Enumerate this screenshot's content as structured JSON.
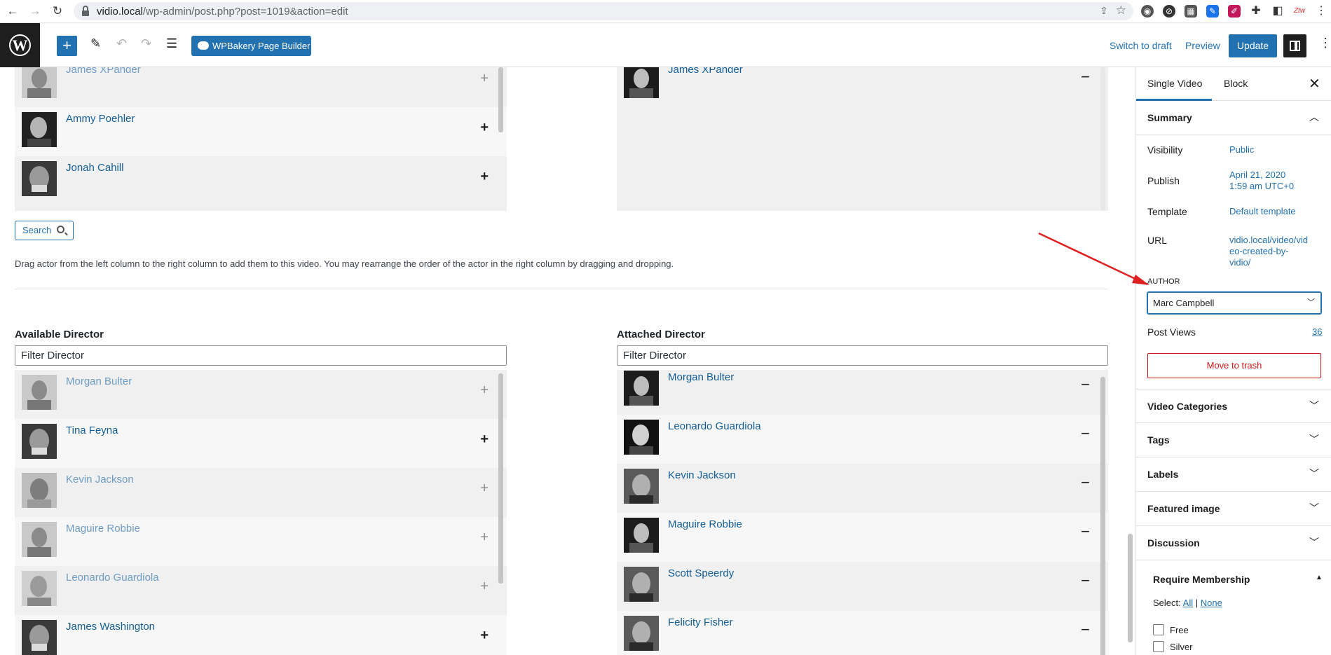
{
  "browser": {
    "url_host": "vidio.local",
    "url_path": "/wp-admin/post.php?post=1019&action=edit"
  },
  "header": {
    "wpbakery_label": "WPBakery Page Builder",
    "switch_to_draft": "Switch to draft",
    "preview": "Preview",
    "update": "Update"
  },
  "actors": {
    "available": [
      {
        "name": "James XPander",
        "faded": true
      },
      {
        "name": "Ammy Poehler",
        "faded": false
      },
      {
        "name": "Jonah Cahill",
        "faded": false
      }
    ],
    "attached": [
      {
        "name": "James XPander"
      }
    ],
    "search_label": "Search",
    "help_text": "Drag actor from the left column to the right column to add them to this video. You may rearrange the order of the actor in the right column by dragging and dropping."
  },
  "directors": {
    "available_title": "Available Director",
    "attached_title": "Attached Director",
    "filter_placeholder": "Filter Director",
    "available": [
      {
        "name": "Morgan Bulter",
        "faded": true
      },
      {
        "name": "Tina Feyna",
        "faded": false
      },
      {
        "name": "Kevin Jackson",
        "faded": true
      },
      {
        "name": "Maguire Robbie",
        "faded": true
      },
      {
        "name": "Leonardo Guardiola",
        "faded": true
      },
      {
        "name": "James Washington",
        "faded": false
      }
    ],
    "attached": [
      {
        "name": "Morgan Bulter"
      },
      {
        "name": "Leonardo Guardiola"
      },
      {
        "name": "Kevin Jackson"
      },
      {
        "name": "Maguire Robbie"
      },
      {
        "name": "Scott Speerdy"
      },
      {
        "name": "Felicity Fisher"
      }
    ]
  },
  "sidebar": {
    "tab_single": "Single Video",
    "tab_block": "Block",
    "summary_title": "Summary",
    "visibility_label": "Visibility",
    "visibility_value": "Public",
    "publish_label": "Publish",
    "publish_value_line1": "April 21, 2020",
    "publish_value_line2": "1:59 am UTC+0",
    "template_label": "Template",
    "template_value": "Default template",
    "url_label": "URL",
    "url_value_line1": "vidio.local/video/vid",
    "url_value_line2": "eo-created-by-",
    "url_value_line3": "vidio/",
    "author_label": "AUTHOR",
    "author_value": "Marc Campbell",
    "post_views_label": "Post Views",
    "post_views_value": "36",
    "move_to_trash": "Move to trash",
    "panels": [
      "Video Categories",
      "Tags",
      "Labels",
      "Featured image",
      "Discussion"
    ],
    "membership_title": "Require Membership",
    "select_label": "Select:",
    "select_all": "All",
    "select_sep": "|",
    "select_none": "None",
    "levels": [
      "Free",
      "Silver"
    ]
  },
  "colors": {
    "accent": "#2271b1",
    "danger": "#cc1818",
    "annotation": "#e02020"
  }
}
